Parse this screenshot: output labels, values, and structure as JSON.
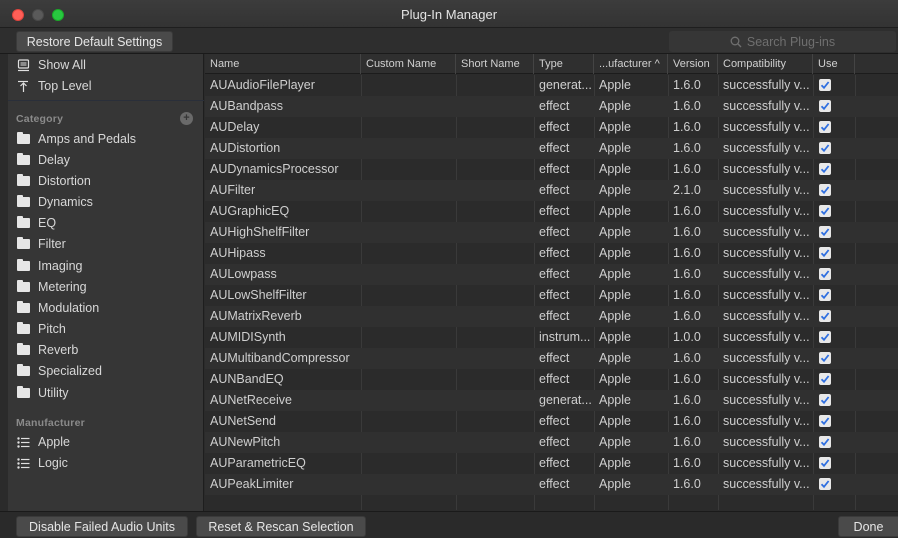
{
  "window": {
    "title": "Plug-In Manager"
  },
  "toolbar": {
    "restore_label": "Restore Default Settings",
    "search_placeholder": "Search Plug-ins"
  },
  "sidebar": {
    "top_items": [
      {
        "label": "Show All",
        "icon": "stack-icon"
      },
      {
        "label": "Top Level",
        "icon": "top-level-icon"
      }
    ],
    "category_header": "Category",
    "categories": [
      "Amps and Pedals",
      "Delay",
      "Distortion",
      "Dynamics",
      "EQ",
      "Filter",
      "Imaging",
      "Metering",
      "Modulation",
      "Pitch",
      "Reverb",
      "Specialized",
      "Utility"
    ],
    "manufacturer_header": "Manufacturer",
    "manufacturers": [
      "Apple",
      "Logic"
    ]
  },
  "table": {
    "columns": [
      "Name",
      "Custom Name",
      "Short Name",
      "Type",
      "...ufacturer ^",
      "Version",
      "Compatibility",
      "Use"
    ],
    "rows": [
      {
        "name": "AUAudioFilePlayer",
        "type": "generat...",
        "manufacturer": "Apple",
        "version": "1.6.0",
        "compat": "successfully v...",
        "use": true
      },
      {
        "name": "AUBandpass",
        "type": "effect",
        "manufacturer": "Apple",
        "version": "1.6.0",
        "compat": "successfully v...",
        "use": true
      },
      {
        "name": "AUDelay",
        "type": "effect",
        "manufacturer": "Apple",
        "version": "1.6.0",
        "compat": "successfully v...",
        "use": true
      },
      {
        "name": "AUDistortion",
        "type": "effect",
        "manufacturer": "Apple",
        "version": "1.6.0",
        "compat": "successfully v...",
        "use": true
      },
      {
        "name": "AUDynamicsProcessor",
        "type": "effect",
        "manufacturer": "Apple",
        "version": "1.6.0",
        "compat": "successfully v...",
        "use": true
      },
      {
        "name": "AUFilter",
        "type": "effect",
        "manufacturer": "Apple",
        "version": "2.1.0",
        "compat": "successfully v...",
        "use": true
      },
      {
        "name": "AUGraphicEQ",
        "type": "effect",
        "manufacturer": "Apple",
        "version": "1.6.0",
        "compat": "successfully v...",
        "use": true
      },
      {
        "name": "AUHighShelfFilter",
        "type": "effect",
        "manufacturer": "Apple",
        "version": "1.6.0",
        "compat": "successfully v...",
        "use": true
      },
      {
        "name": "AUHipass",
        "type": "effect",
        "manufacturer": "Apple",
        "version": "1.6.0",
        "compat": "successfully v...",
        "use": true
      },
      {
        "name": "AULowpass",
        "type": "effect",
        "manufacturer": "Apple",
        "version": "1.6.0",
        "compat": "successfully v...",
        "use": true
      },
      {
        "name": "AULowShelfFilter",
        "type": "effect",
        "manufacturer": "Apple",
        "version": "1.6.0",
        "compat": "successfully v...",
        "use": true
      },
      {
        "name": "AUMatrixReverb",
        "type": "effect",
        "manufacturer": "Apple",
        "version": "1.6.0",
        "compat": "successfully v...",
        "use": true
      },
      {
        "name": "AUMIDISynth",
        "type": "instrum...",
        "manufacturer": "Apple",
        "version": "1.0.0",
        "compat": "successfully v...",
        "use": true
      },
      {
        "name": "AUMultibandCompressor",
        "type": "effect",
        "manufacturer": "Apple",
        "version": "1.6.0",
        "compat": "successfully v...",
        "use": true
      },
      {
        "name": "AUNBandEQ",
        "type": "effect",
        "manufacturer": "Apple",
        "version": "1.6.0",
        "compat": "successfully v...",
        "use": true
      },
      {
        "name": "AUNetReceive",
        "type": "generat...",
        "manufacturer": "Apple",
        "version": "1.6.0",
        "compat": "successfully v...",
        "use": true
      },
      {
        "name": "AUNetSend",
        "type": "effect",
        "manufacturer": "Apple",
        "version": "1.6.0",
        "compat": "successfully v...",
        "use": true
      },
      {
        "name": "AUNewPitch",
        "type": "effect",
        "manufacturer": "Apple",
        "version": "1.6.0",
        "compat": "successfully v...",
        "use": true
      },
      {
        "name": "AUParametricEQ",
        "type": "effect",
        "manufacturer": "Apple",
        "version": "1.6.0",
        "compat": "successfully v...",
        "use": true
      },
      {
        "name": "AUPeakLimiter",
        "type": "effect",
        "manufacturer": "Apple",
        "version": "1.6.0",
        "compat": "successfully v...",
        "use": true
      }
    ]
  },
  "bottom": {
    "disable_label": "Disable Failed Audio Units",
    "rescan_label": "Reset & Rescan Selection",
    "done_label": "Done"
  },
  "colors": {
    "checkbox_accent": "#2f6fe0",
    "close": "#ff5f57",
    "zoom": "#28c840"
  }
}
